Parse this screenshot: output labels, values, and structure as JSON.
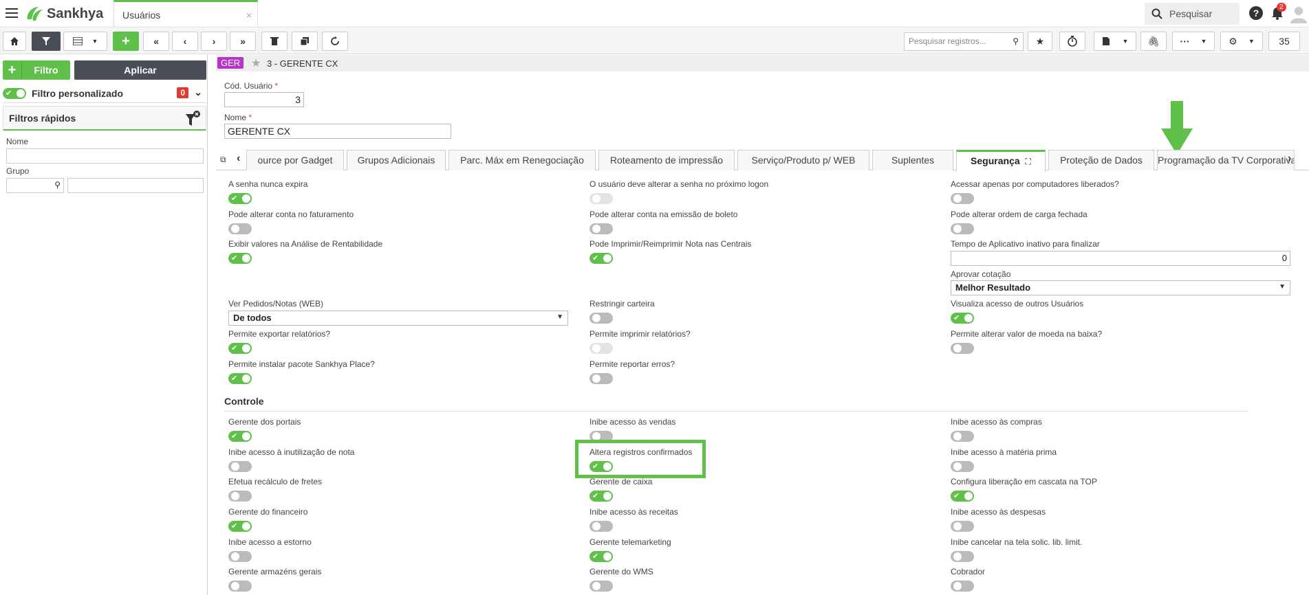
{
  "app": {
    "logo_text": "Sankhya",
    "tab_title": "Usuários",
    "tab_close": "×",
    "search_label": "Pesquisar",
    "help_label": "?",
    "notification_count": "2",
    "accent_color": "#5fc04a"
  },
  "toolbar": {
    "search_placeholder": "Pesquisar registros...",
    "page_size": "35",
    "buttons": [
      "home-icon",
      "filter-icon",
      "grid-icon",
      "add",
      "first",
      "prev",
      "next",
      "last",
      "delete",
      "copy",
      "refresh",
      "star",
      "timer",
      "report",
      "clip",
      "more",
      "settings"
    ]
  },
  "left": {
    "filtro_label": "Filtro",
    "aplicar_label": "Aplicar",
    "filtro_personalizado": "Filtro personalizado",
    "filter_count": "0",
    "filtros_rapidos": "Filtros rápidos",
    "nome_label": "Nome",
    "grupo_label": "Grupo"
  },
  "record": {
    "badge": "GER",
    "title": "3 - GERENTE CX",
    "cod_label": "Cód. Usuário",
    "cod_value": "3",
    "nome_label": "Nome",
    "nome_value": "GERENTE CX"
  },
  "tabs": [
    "ource por Gadget",
    "Grupos Adicionais",
    "Parc. Máx em Renegociação",
    "Roteamento de impressão",
    "Serviço/Produto p/ WEB",
    "Suplentes",
    "Segurança",
    "Proteção de Dados",
    "Programação da TV Corporativa"
  ],
  "fields": {
    "senha_nunca_expira": "A senha nunca expira",
    "alterar_senha": "O usuário deve alterar a senha no próximo logon",
    "computadores_liberados": "Acessar apenas por computadores liberados?",
    "alterar_conta_fat": "Pode alterar conta no faturamento",
    "alterar_conta_boleto": "Pode alterar conta na emissão de boleto",
    "alterar_ordem_carga": "Pode alterar ordem de carga fechada",
    "exibir_valores": "Exibir valores na Análise de Rentabilidade",
    "imprimir_nota": "Pode Imprimir/Reimprimir Nota nas Centrais",
    "tempo_inativo": "Tempo de Aplicativo inativo para finalizar",
    "tempo_inativo_value": "0",
    "aprovar_cotacao": "Aprovar cotação",
    "aprovar_cotacao_value": "Melhor Resultado",
    "ver_pedidos": "Ver Pedidos/Notas (WEB)",
    "ver_pedidos_value": "De todos",
    "restringir_carteira": "Restringir carteira",
    "visualiza_acesso": "Visualiza acesso de outros Usuários",
    "exportar_relatorios": "Permite exportar relatórios?",
    "imprimir_relatorios": "Permite imprimir relatórios?",
    "alterar_moeda": "Permite alterar valor de moeda na baixa?",
    "instalar_pacote": "Permite instalar pacote Sankhya Place?",
    "reportar_erros": "Permite reportar erros?",
    "controle": "Controle",
    "gerente_portais": "Gerente dos portais",
    "inibe_vendas": "Inibe acesso às vendas",
    "inibe_compras": "Inibe acesso às compras",
    "inibe_inutilizacao": "Inibe acesso à inutilização de nota",
    "altera_registros": "Altera registros confirmados",
    "inibe_materia": "Inibe acesso à matéria prima",
    "recalculo_fretes": "Efetua recálculo de fretes",
    "gerente_caixa": "Gerente de caixa",
    "config_cascata": "Configura liberação em cascata na TOP",
    "gerente_financeiro": "Gerente do financeiro",
    "inibe_receitas": "Inibe acesso às receitas",
    "inibe_despesas": "Inibe acesso às despesas",
    "inibe_estorno": "Inibe acesso a estorno",
    "gerente_telemarketing": "Gerente telemarketing",
    "inibe_cancelar": "Inibe cancelar na tela solic. lib. limit.",
    "gerente_armazens": "Gerente armazéns gerais",
    "gerente_wms": "Gerente do WMS",
    "cobrador": "Cobrador"
  }
}
